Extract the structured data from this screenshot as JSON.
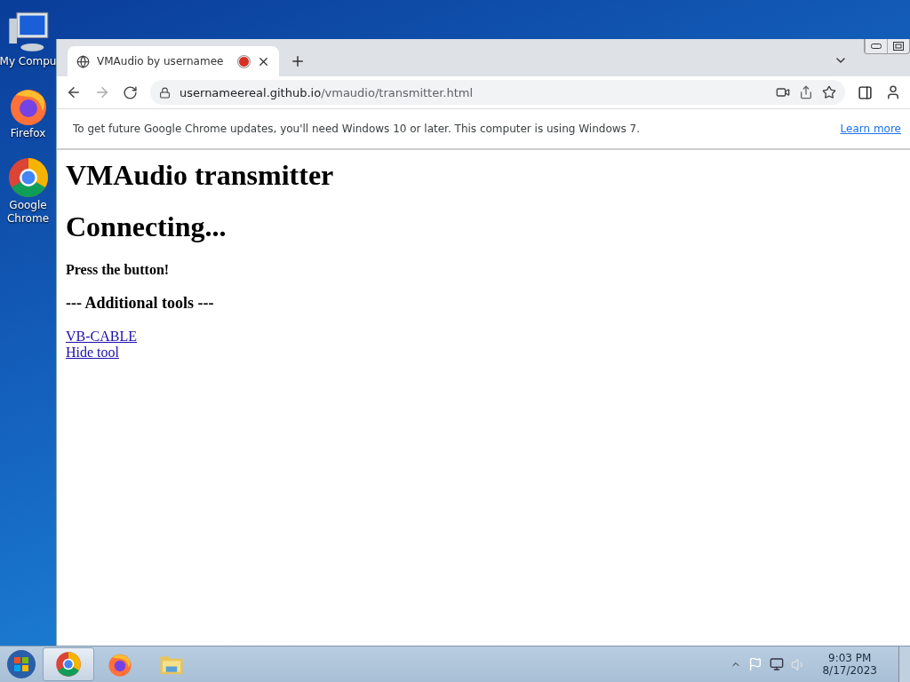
{
  "desktop_icons": [
    {
      "kind": "computer",
      "label": "My Compu"
    },
    {
      "kind": "firefox",
      "label": "Firefox"
    },
    {
      "kind": "chrome",
      "label": "Google Chrome"
    }
  ],
  "browser": {
    "tab": {
      "title": "VMAudio by usernamee",
      "recording": true,
      "selected": true
    },
    "address": {
      "host": "usernameereal.github.io",
      "path": "/vmaudio/transmitter.html"
    },
    "infobar": {
      "message": "To get future Google Chrome updates, you'll need Windows 10 or later. This computer is using Windows 7.",
      "link": "Learn more"
    },
    "page": {
      "title": "VMAudio transmitter",
      "status": "Connecting...",
      "instruction": "Press the button!",
      "section": "--- Additional tools ---",
      "links": [
        "VB-CABLE",
        "Hide tool"
      ]
    }
  },
  "taskbar": {
    "apps": [
      {
        "kind": "chrome",
        "selected": true
      },
      {
        "kind": "firefox",
        "selected": false
      },
      {
        "kind": "explorer",
        "selected": false
      }
    ],
    "clock": {
      "time": "9:03 PM",
      "date": "8/17/2023"
    }
  }
}
